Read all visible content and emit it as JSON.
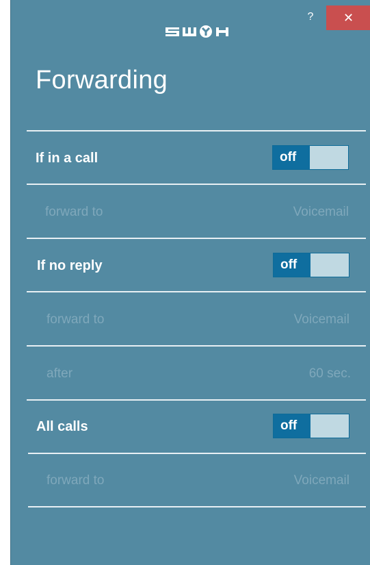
{
  "window": {
    "title": "Forwarding",
    "help_label": "?",
    "close_label": "✕",
    "logo_icon": "swyx-logo-icon"
  },
  "colors": {
    "background": "#538aa2",
    "toggle_active": "#0f6e9f",
    "toggle_track": "#c0d9e2",
    "close": "#c94f4f",
    "muted_text": "#7fa8bb"
  },
  "sections": [
    {
      "label": "If in a call",
      "toggle": "off",
      "rows": [
        {
          "label": "forward to",
          "value": "Voicemail"
        }
      ]
    },
    {
      "label": "If no reply",
      "toggle": "off",
      "rows": [
        {
          "label": "forward to",
          "value": "Voicemail"
        },
        {
          "label": "after",
          "value": "60 sec."
        }
      ]
    },
    {
      "label": "All calls",
      "toggle": "off",
      "rows": [
        {
          "label": "forward to",
          "value": "Voicemail"
        }
      ]
    }
  ]
}
